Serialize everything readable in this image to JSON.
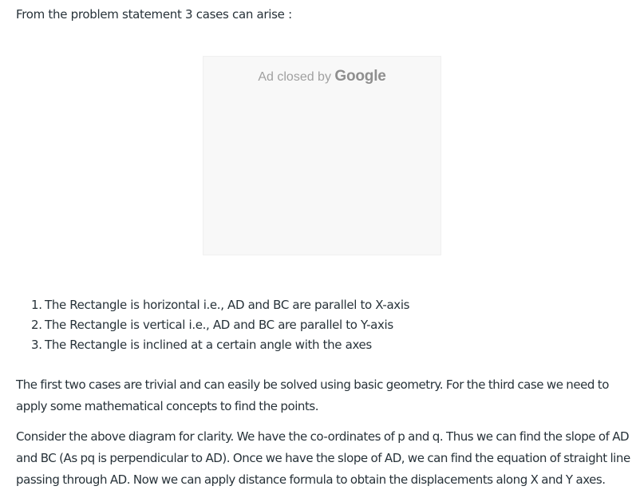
{
  "intro": "From the problem statement 3 cases can arise :",
  "ad": {
    "text": "Ad closed by",
    "brand": "Google"
  },
  "cases": [
    {
      "number": "1.",
      "text": "The Rectangle is horizontal i.e., AD and BC are parallel to X-axis"
    },
    {
      "number": "2.",
      "text": "The Rectangle is vertical i.e., AD and BC are parallel to Y-axis"
    },
    {
      "number": "3.",
      "text": "The Rectangle is inclined at a certain angle with the axes"
    }
  ],
  "paragraphs": [
    "The first two cases are trivial and can easily be solved using basic geometry. For the third case we need to apply some mathematical concepts to find the points.",
    "Consider the above diagram for clarity. We have the co-ordinates of p and q. Thus we can find the slope of AD and BC (As pq is perpendicular to AD). Once we have the slope of AD, we can find the equation of straight line passing through AD. Now we can apply distance formula to obtain the displacements along X and Y axes."
  ]
}
